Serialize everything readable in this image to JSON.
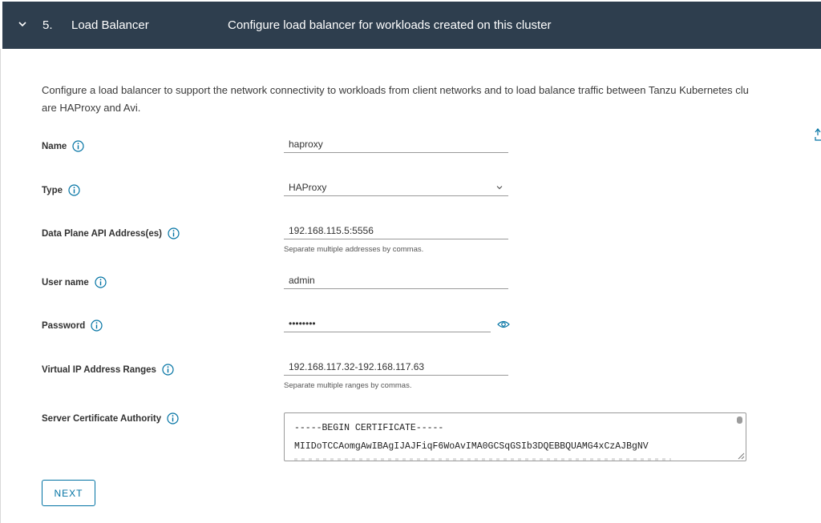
{
  "header": {
    "step_number": "5.",
    "step_title": "Load Balancer",
    "step_description": "Configure load balancer for workloads created on this cluster"
  },
  "intro": {
    "line1": "Configure a load balancer to support the network connectivity to workloads from client networks and to load balance traffic between Tanzu Kubernetes clu",
    "line2": "are HAProxy and Avi."
  },
  "form": {
    "name": {
      "label": "Name",
      "value": "haproxy"
    },
    "type": {
      "label": "Type",
      "value": "HAProxy"
    },
    "data_plane": {
      "label": "Data Plane API Address(es)",
      "value": "192.168.115.5:5556",
      "helper": "Separate multiple addresses by commas."
    },
    "username": {
      "label": "User name",
      "value": "admin"
    },
    "password": {
      "label": "Password",
      "value": "••••••••"
    },
    "vip_ranges": {
      "label": "Virtual IP Address Ranges",
      "value": "192.168.117.32-192.168.117.63",
      "helper": "Separate multiple ranges by commas."
    },
    "server_ca": {
      "label": "Server Certificate Authority",
      "line1": "-----BEGIN CERTIFICATE-----",
      "line2": "MIIDoTCCAomgAwIBAgIJAJFiqF6WoAvIMA0GCSqGSIb3DQEBBQUAMG4xCzAJBgNV"
    }
  },
  "buttons": {
    "next": "NEXT"
  },
  "colors": {
    "header_bg": "#2e3e4e",
    "accent": "#0072a3"
  }
}
